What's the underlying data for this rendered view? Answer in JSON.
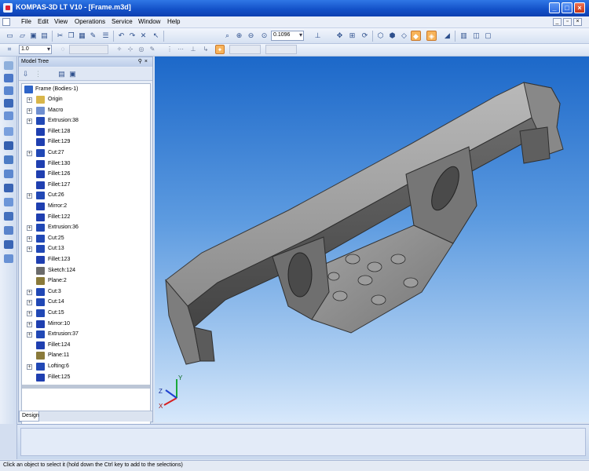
{
  "window": {
    "title": "KOMPAS-3D LT V10 - [Frame.m3d]",
    "controls": {
      "minimize": "_",
      "maximize": "□",
      "close": "×"
    }
  },
  "menu": {
    "items": [
      "File",
      "Edit",
      "View",
      "Operations",
      "Service",
      "Window",
      "Help"
    ]
  },
  "toolbar": {
    "zoom_value": "0.1096",
    "scale_value": "1.0",
    "icons": [
      "new-document-icon",
      "open-icon",
      "save-icon",
      "print-icon",
      "cut-icon",
      "copy-icon",
      "paste-icon",
      "format-icon",
      "properties-icon",
      "undo-icon",
      "redo-icon",
      "delete-icon",
      "help-pointer-icon",
      "zoom-window-icon",
      "zoom-in-icon",
      "zoom-out-icon",
      "zoom-scale-icon",
      "orientation-icon",
      "pan-icon",
      "zoom-all-icon",
      "rotate-icon",
      "wireframe-icon",
      "hidden-lines-icon",
      "hidden-thin-icon",
      "shaded-icon",
      "shaded-edges-icon",
      "perspective-icon",
      "library-icon",
      "section-icon",
      "view-manager-icon"
    ]
  },
  "model_tree": {
    "title": "Model Tree",
    "root": "Frame (Bodies-1)",
    "items": [
      {
        "label": "Origin",
        "expandable": true,
        "color": "#d9b64a"
      },
      {
        "label": "Macro",
        "expandable": true,
        "color": "#6f8fd0"
      },
      {
        "label": "Extrusion:38",
        "expandable": true,
        "color": "#2148b5"
      },
      {
        "label": "Fillet:128",
        "expandable": false,
        "color": "#1f3fb0"
      },
      {
        "label": "Fillet:129",
        "expandable": false,
        "color": "#1f3fb0"
      },
      {
        "label": "Cut:27",
        "expandable": true,
        "color": "#2148b5"
      },
      {
        "label": "Fillet:130",
        "expandable": false,
        "color": "#1f3fb0"
      },
      {
        "label": "Fillet:126",
        "expandable": false,
        "color": "#1f3fb0"
      },
      {
        "label": "Fillet:127",
        "expandable": false,
        "color": "#1f3fb0"
      },
      {
        "label": "Cut:26",
        "expandable": true,
        "color": "#2148b5"
      },
      {
        "label": "Mirror:2",
        "expandable": false,
        "color": "#1f3fb0"
      },
      {
        "label": "Fillet:122",
        "expandable": false,
        "color": "#1f3fb0"
      },
      {
        "label": "Extrusion:36",
        "expandable": true,
        "color": "#2148b5"
      },
      {
        "label": "Cut:25",
        "expandable": true,
        "color": "#2148b5"
      },
      {
        "label": "Cut:13",
        "expandable": true,
        "color": "#2148b5"
      },
      {
        "label": "Fillet:123",
        "expandable": false,
        "color": "#1f3fb0"
      },
      {
        "label": "Sketch:124",
        "expandable": false,
        "color": "#6b6b6b"
      },
      {
        "label": "Plane:2",
        "expandable": false,
        "color": "#8a7a3a"
      },
      {
        "label": "Cut:3",
        "expandable": true,
        "color": "#2148b5"
      },
      {
        "label": "Cut:14",
        "expandable": true,
        "color": "#2148b5"
      },
      {
        "label": "Cut:15",
        "expandable": true,
        "color": "#2148b5"
      },
      {
        "label": "Mirror:10",
        "expandable": true,
        "color": "#1f3fb0"
      },
      {
        "label": "Extrusion:37",
        "expandable": true,
        "color": "#2148b5"
      },
      {
        "label": "Fillet:124",
        "expandable": false,
        "color": "#1f3fb0"
      },
      {
        "label": "Plane:11",
        "expandable": false,
        "color": "#8a7a3a"
      },
      {
        "label": "Lofting:6",
        "expandable": true,
        "color": "#2148b5"
      },
      {
        "label": "Fillet:125",
        "expandable": false,
        "color": "#1f3fb0"
      }
    ],
    "tab": "Design"
  },
  "viewport": {
    "triad": {
      "x": "X",
      "y": "Y",
      "z": "Z"
    }
  },
  "status": {
    "text": "Click an object to select it (hold down the Ctrl key to add to the selections)"
  },
  "colors": {
    "title_bar": "#1452c9",
    "viewport_top": "#1c68c9",
    "viewport_bottom": "#d7e8fb",
    "model_gray": "#8a8a8a",
    "active_tool": "#f7b35a"
  }
}
